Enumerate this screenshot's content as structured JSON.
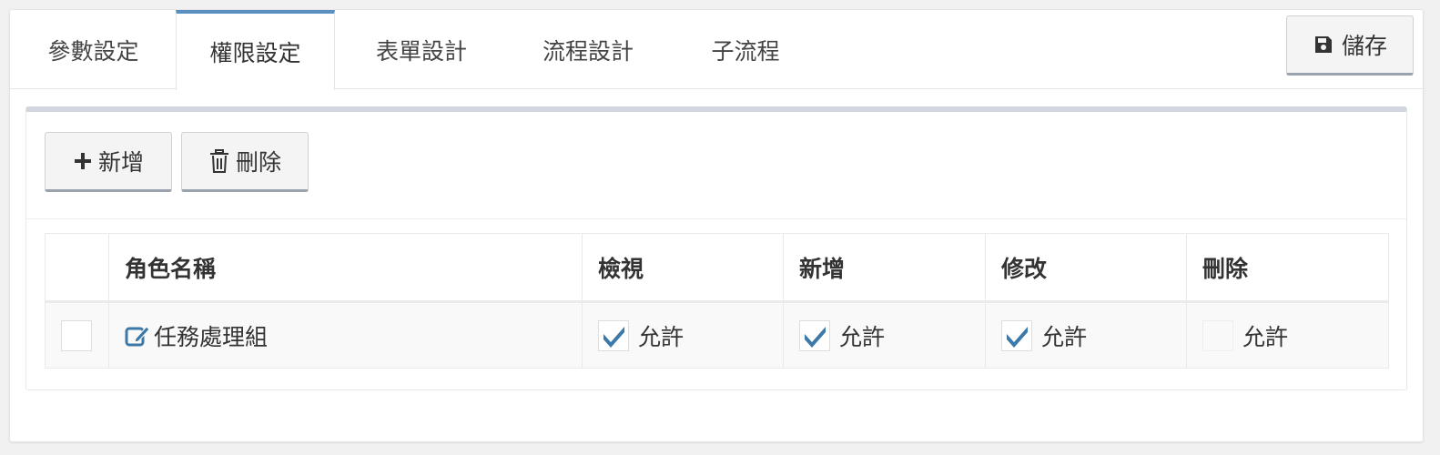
{
  "tabs": [
    {
      "label": "參數設定"
    },
    {
      "label": "權限設定"
    },
    {
      "label": "表單設計"
    },
    {
      "label": "流程設計"
    },
    {
      "label": "子流程"
    }
  ],
  "header": {
    "save_label": "儲存"
  },
  "toolbar": {
    "add_label": "新增",
    "delete_label": "刪除"
  },
  "table": {
    "columns": [
      "",
      "角色名稱",
      "檢視",
      "新增",
      "修改",
      "刪除"
    ],
    "rows": [
      {
        "selected": false,
        "role": "任務處理組",
        "view": {
          "label": "允許",
          "checked": true
        },
        "add": {
          "label": "允許",
          "checked": true
        },
        "edit": {
          "label": "允許",
          "checked": true
        },
        "delete": {
          "label": "允許",
          "checked": false
        }
      }
    ]
  },
  "colors": {
    "accent": "#5b8fc0",
    "check": "#3c79a8"
  }
}
